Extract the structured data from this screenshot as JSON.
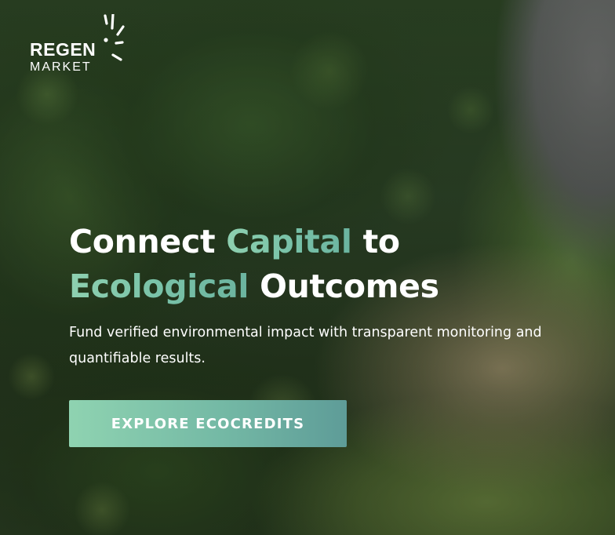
{
  "brand": {
    "name_top": "REGEN",
    "name_bottom": "MARKET",
    "logo_icon": "sunburst-rays-icon"
  },
  "hero": {
    "headline": {
      "line1": [
        {
          "text": "Connect ",
          "accent": false
        },
        {
          "text": "Capital",
          "accent": true
        },
        {
          "text": " to",
          "accent": false
        }
      ],
      "line2": [
        {
          "text": "Ecological",
          "accent": true
        },
        {
          "text": " Outcomes",
          "accent": false
        }
      ]
    },
    "subtitle": "Fund verified environmental impact with transparent monitoring and quantifiable results.",
    "cta_label": "EXPLORE ECOCREDITS"
  },
  "colors": {
    "accent_start": "#8ed0b0",
    "accent_end": "#5e9c98",
    "text": "#ffffff"
  }
}
